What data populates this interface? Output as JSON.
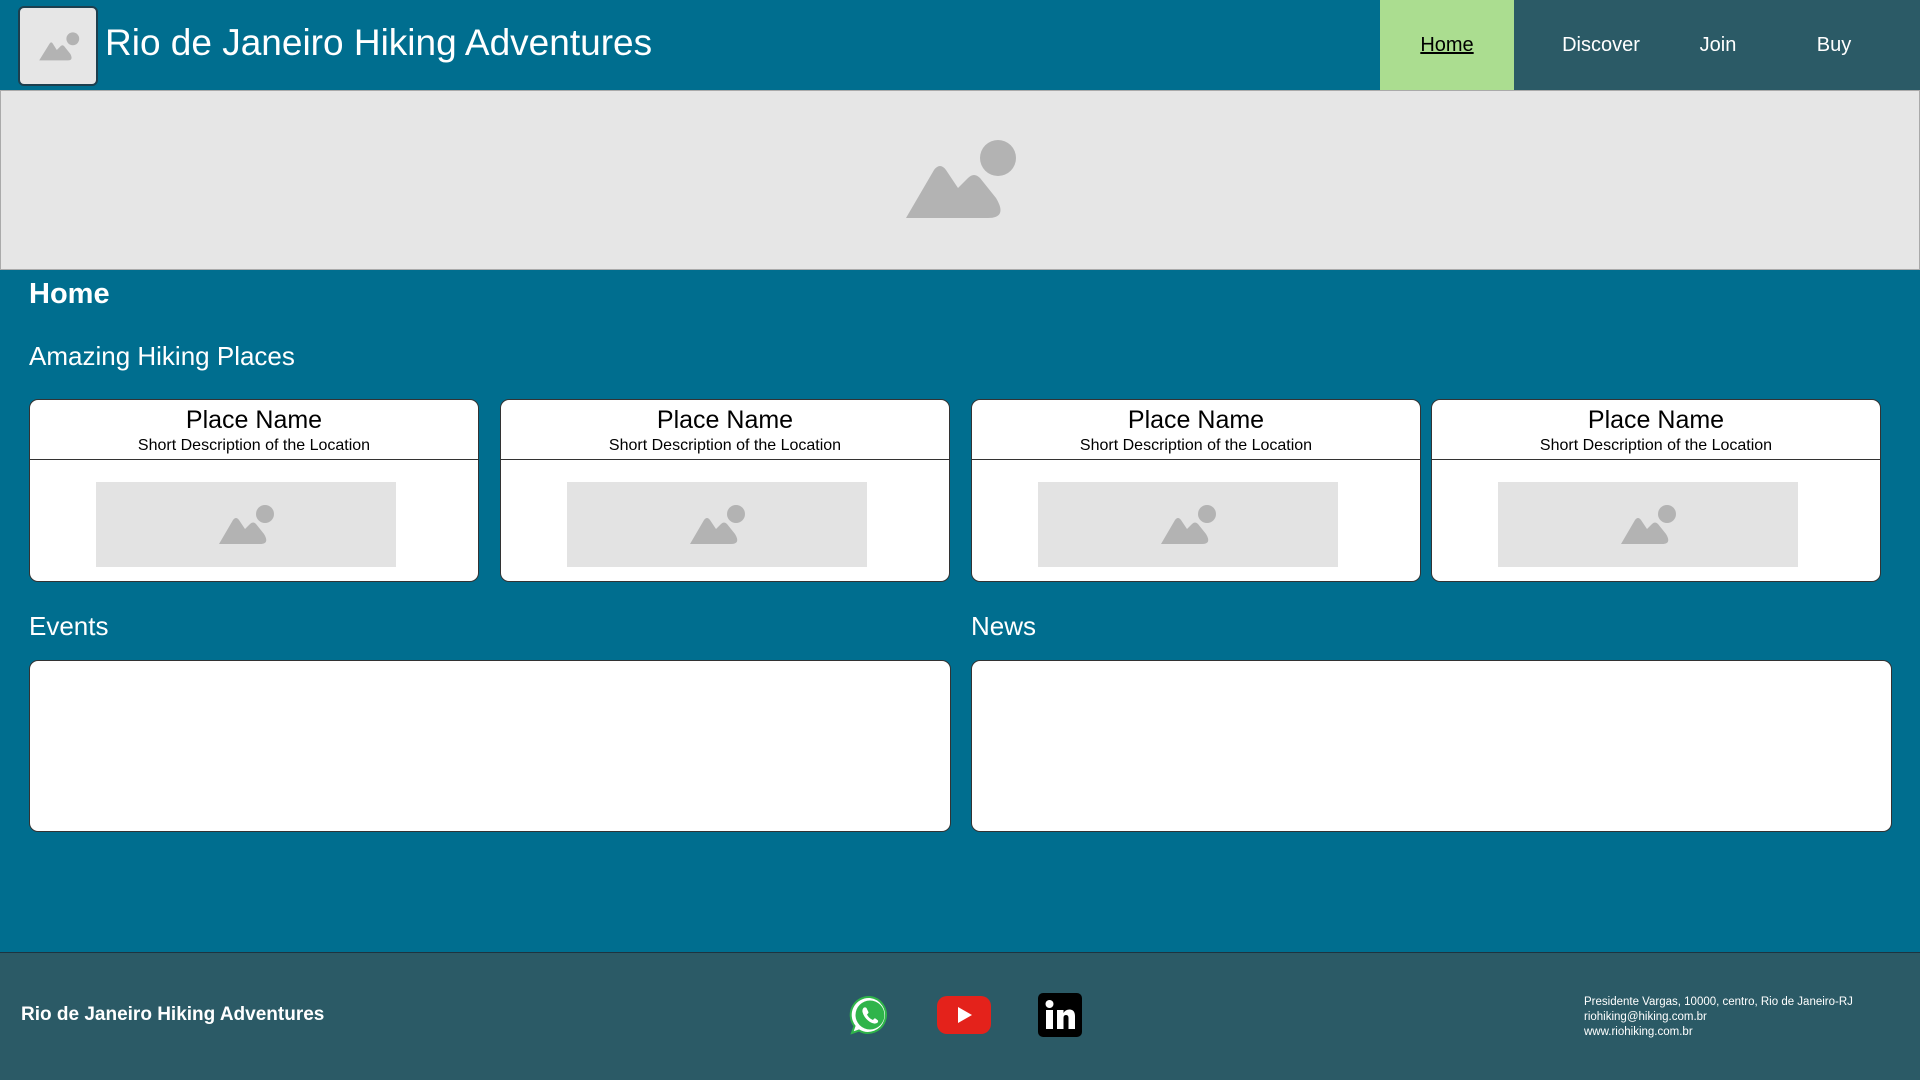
{
  "header": {
    "title": "Rio de Janeiro Hiking Adventures",
    "logo_icon": "image-placeholder-icon",
    "nav": [
      {
        "label": "Home",
        "active": true
      },
      {
        "label": "Discover",
        "active": false
      },
      {
        "label": "Join",
        "active": false
      },
      {
        "label": "Buy",
        "active": false
      }
    ]
  },
  "hero": {
    "icon": "image-placeholder-icon"
  },
  "main": {
    "heading": "Home",
    "places_title": "Amazing Hiking Places",
    "places": [
      {
        "name": "Place Name",
        "description": "Short Description of the Location"
      },
      {
        "name": "Place Name",
        "description": "Short Description of the Location"
      },
      {
        "name": "Place Name",
        "description": "Short Description of the Location"
      },
      {
        "name": "Place Name",
        "description": "Short Description of the Location"
      }
    ],
    "events_title": "Events",
    "news_title": "News"
  },
  "footer": {
    "title": "Rio de Janeiro Hiking Adventures",
    "social": [
      "whatsapp-icon",
      "youtube-icon",
      "linkedin-icon"
    ],
    "address": "Presidente Vargas, 10000, centro, Rio de Janeiro-RJ",
    "email": "riohiking@hiking.com.br",
    "website": "www.riohiking.com.br"
  },
  "colors": {
    "background": "#006e8f",
    "nav_bg": "#2b5a66",
    "nav_active": "#abdd90",
    "placeholder": "#e6e6e6"
  }
}
